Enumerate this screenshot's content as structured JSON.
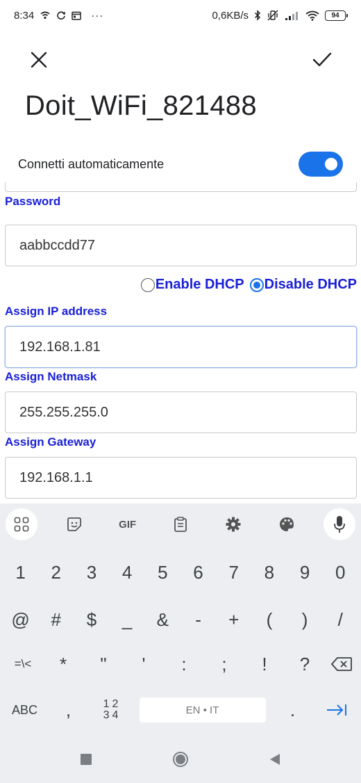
{
  "status_bar": {
    "time": "8:34",
    "network_speed": "0,6KB/s",
    "battery": "94",
    "more": "···"
  },
  "dialog": {
    "ssid": "Doit_WiFi_821488",
    "auto_connect_label": "Connetti automaticamente",
    "auto_connect_on": true
  },
  "form": {
    "password_label": "Password",
    "password_value": "aabbccdd77",
    "dhcp_enable_label": "Enable DHCP",
    "dhcp_disable_label": "Disable DHCP",
    "ip_label": "Assign IP address",
    "ip_value": "192.168.1.81",
    "netmask_label": "Assign Netmask",
    "netmask_value": "255.255.255.0",
    "gateway_label": "Assign Gateway",
    "gateway_value": "192.168.1.1"
  },
  "keyboard": {
    "gif_label": "GIF",
    "row1": [
      "1",
      "2",
      "3",
      "4",
      "5",
      "6",
      "7",
      "8",
      "9",
      "0"
    ],
    "row2": [
      "@",
      "#",
      "$",
      "_",
      "&",
      "-",
      "+",
      "(",
      ")",
      "/"
    ],
    "row3": [
      "=\\<",
      "*",
      "\"",
      "'",
      ":",
      ";",
      "!",
      "?"
    ],
    "abc_label": "ABC",
    "comma": ",",
    "numpad_top": "12",
    "numpad_bottom": "34",
    "space_label": "EN • IT",
    "period": "."
  },
  "colors": {
    "accent": "#1a73e8",
    "form_label": "#1a20d6",
    "keyboard_bg": "#eceef1"
  }
}
